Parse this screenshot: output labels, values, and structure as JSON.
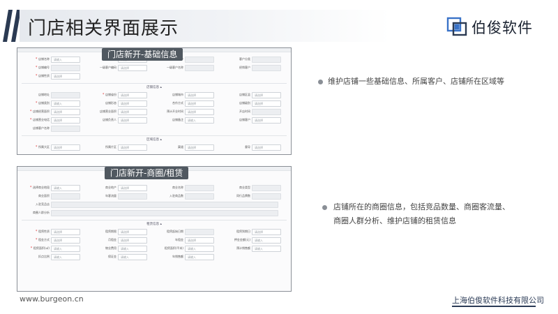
{
  "header": {
    "title": "门店相关界面展示"
  },
  "brand": {
    "name": "伯俊软件",
    "company": "上海伯俊软件科技有限公司",
    "url": "www.burgeon.cn",
    "accent": "#3a73c8"
  },
  "screens": [
    {
      "caption": "门店新开-基础信息",
      "rows": [
        {
          "items": [
            {
              "label": "店铺名称",
              "value": "请输入",
              "req": true
            },
            {
              "label": "店铺类型",
              "value": "请选择"
            },
            {
              "label": "所属客户",
              "value": ""
            },
            {
              "label": "客户分类",
              "value": ""
            }
          ]
        },
        {
          "items": [
            {
              "label": "店铺编号",
              "value": "",
              "req": true
            },
            {
              "label": "一级客户编码",
              "value": "请选择"
            },
            {
              "label": "一级客户名称",
              "value": ""
            },
            {
              "label": "经销客户",
              "value": ""
            }
          ]
        },
        {
          "items": [
            {
              "label": "店铺性质",
              "value": "请选择",
              "req": true
            }
          ]
        },
        {
          "section": "店铺信息"
        },
        {
          "items": [
            {
              "label": "店铺地址",
              "value": ""
            },
            {
              "label": "店铺省份",
              "value": "请选择",
              "req": true
            },
            {
              "label": "店铺城市",
              "value": "请选择"
            },
            {
              "label": "店铺区县",
              "value": "请选择"
            }
          ]
        },
        {
          "items": [
            {
              "label": "店铺类别",
              "value": "请输入",
              "req": true
            },
            {
              "label": "店铺形态",
              "value": "请选择"
            },
            {
              "label": "合作方式",
              "value": "请选择"
            },
            {
              "label": "店铺级别",
              "value": "请选择"
            }
          ]
        },
        {
          "items": [
            {
              "label": "店铺经营面积",
              "value": "请选择",
              "req": true
            },
            {
              "label": "店铺营业面积",
              "value": "请选择"
            },
            {
              "label": "预计开业时间",
              "value": "请选择"
            },
            {
              "label": "开店时间",
              "value": ""
            }
          ]
        },
        {
          "items": [
            {
              "label": "店铺营业电话",
              "value": "请选择",
              "req": true
            },
            {
              "label": "店铺负责人",
              "value": "请选择"
            },
            {
              "label": "店铺备注",
              "value": "请输入"
            },
            {
              "label": "店铺客户",
              "value": "请选择"
            }
          ]
        },
        {
          "items": [
            {
              "label": "店铺客户名称",
              "value": ""
            }
          ]
        },
        {
          "section": "区域信息"
        },
        {
          "items": [
            {
              "label": "所属大区",
              "value": "请选择",
              "req": true
            },
            {
              "label": "所属片区",
              "value": "请选择"
            },
            {
              "label": "渠道",
              "value": "请选择"
            },
            {
              "label": "督导",
              "value": "请选择"
            }
          ]
        }
      ]
    },
    {
      "caption": "门店新开-商圈/租赁",
      "rows": [
        {
          "items": [
            {
              "label": "选择商业地段",
              "value": "请输入",
              "req": true
            },
            {
              "label": "商业地产",
              "value": "请选择"
            },
            {
              "label": "商业名称",
              "value": ""
            },
            {
              "label": "商业类型",
              "value": ""
            }
          ]
        },
        {
          "items": [
            {
              "label": "商业面积",
              "value": ""
            },
            {
              "label": "年客流量",
              "value": ""
            },
            {
              "label": "入驻商品数",
              "value": ""
            },
            {
              "label": "同行品牌数",
              "value": ""
            }
          ]
        },
        {
          "items": [
            {
              "label": "入驻竞品店",
              "value": "",
              "wide": true
            }
          ]
        },
        {
          "items": [
            {
              "label": "商圈人群分析",
              "value": "",
              "wide": true
            }
          ]
        },
        {
          "section": "租赁信息"
        },
        {
          "items": [
            {
              "label": "租赁性质",
              "value": "请选择",
              "req": true
            },
            {
              "label": "租赁期限",
              "value": "请选择"
            },
            {
              "label": "租赁起始日期",
              "value": ""
            },
            {
              "label": "租赁到期日",
              "value": "请选择"
            }
          ]
        },
        {
          "items": [
            {
              "label": "租金方式",
              "value": "请选择",
              "req": true
            },
            {
              "label": "月租金",
              "value": "请选择"
            },
            {
              "label": "年租金",
              "value": "请选择"
            },
            {
              "label": "押金金额(元)",
              "value": "请输入"
            }
          ]
        },
        {
          "items": [
            {
              "label": "租赁面积(㎡)",
              "value": "请输入",
              "req": true
            },
            {
              "label": "物业费用",
              "value": "请输入"
            },
            {
              "label": "租赁面积(平米)",
              "value": "请输入"
            },
            {
              "label": "预计销售额",
              "value": "请输入"
            }
          ]
        },
        {
          "items": [
            {
              "label": "扣点比例",
              "value": "请输入"
            },
            {
              "label": "保证金",
              "value": "请输入"
            },
            {
              "label": "年销售额",
              "value": "请输入"
            }
          ]
        }
      ]
    }
  ],
  "bullets": [
    {
      "text": "维护店铺一些基础信息、所属客户、店铺所在区域等"
    },
    {
      "text": "店铺所在的商圈信息，包括竞品数量、商圈客流量、",
      "text2": "商圈人群分析、维护店铺的租赁信息"
    }
  ]
}
